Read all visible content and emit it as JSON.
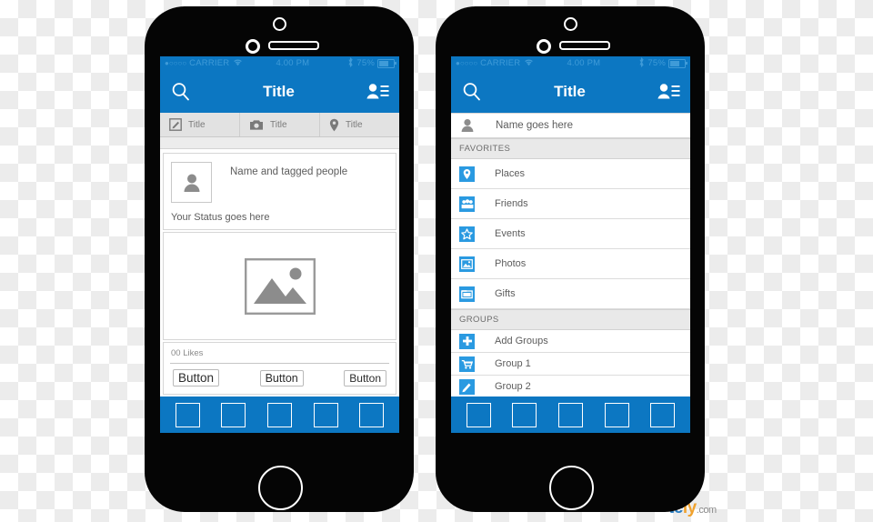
{
  "status_bar": {
    "dots": "●○○○○",
    "carrier": "CARRIER",
    "wifi_icon": "wifi-icon",
    "time": "4.00 PM",
    "bluetooth_icon": "bluetooth-icon",
    "battery_percent": "75%",
    "battery_icon": "battery-icon"
  },
  "colors": {
    "primary_blue": "#0c77c2",
    "status_text_blue": "#3f9bd8",
    "icon_blue": "#2a9ae1",
    "frame_black": "#050505",
    "text_gray": "#5c5c5c"
  },
  "left_phone": {
    "navbar": {
      "search_icon": "search-icon",
      "title": "Title",
      "contacts_icon": "contacts-icon"
    },
    "tabs": [
      {
        "icon": "compose-icon",
        "label": "Title"
      },
      {
        "icon": "camera-icon",
        "label": "Title"
      },
      {
        "icon": "location-icon",
        "label": "Title"
      }
    ],
    "post": {
      "avatar_icon": "person-avatar-icon",
      "name": "Name and tagged people",
      "status": "Your Status goes here",
      "photo_placeholder_icon": "image-placeholder-icon"
    },
    "likes": {
      "count_text": "00 Likes",
      "buttons": [
        "Button",
        "Button",
        "Button"
      ]
    },
    "bottom_tabs": [
      "tab-square-1",
      "tab-square-2",
      "tab-square-3",
      "tab-square-4",
      "tab-square-5"
    ]
  },
  "right_phone": {
    "navbar": {
      "search_icon": "search-icon",
      "title": "Title",
      "contacts_icon": "contacts-icon"
    },
    "profile": {
      "avatar_icon": "person-avatar-icon",
      "name": "Name goes here"
    },
    "sections": [
      {
        "header": "FAVORITES",
        "items": [
          {
            "icon": "location-pin-icon",
            "label": "Places"
          },
          {
            "icon": "friends-icon",
            "label": "Friends"
          },
          {
            "icon": "star-icon",
            "label": "Events"
          },
          {
            "icon": "photo-icon",
            "label": "Photos"
          },
          {
            "icon": "folder-icon",
            "label": "Gifts"
          }
        ]
      },
      {
        "header": "GROUPS",
        "items": [
          {
            "icon": "plus-icon",
            "label": "Add Groups"
          },
          {
            "icon": "cart-icon",
            "label": "Group 1"
          },
          {
            "icon": "pencil-icon",
            "label": "Group 2"
          }
        ]
      }
    ],
    "bottom_tabs": [
      "tab-square-1",
      "tab-square-2",
      "tab-square-3",
      "tab-square-4",
      "tab-square-5"
    ]
  },
  "watermark": {
    "part_a": "te",
    "part_b": "ly",
    "part_c": ".com"
  }
}
